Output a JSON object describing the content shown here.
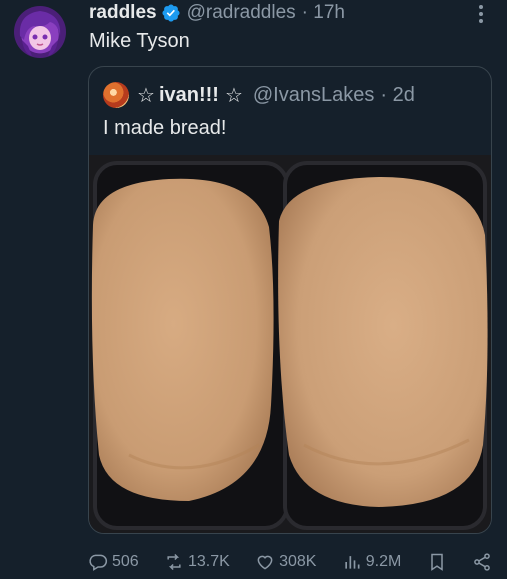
{
  "tweet": {
    "author_name": "raddles",
    "handle": "@radraddles",
    "time": "· 17h",
    "text": "Mike Tyson"
  },
  "quoted": {
    "author_name": "ivan!!!",
    "handle": "@IvansLakes",
    "time": "· 2d",
    "text": "I made bread!",
    "stars": "☆"
  },
  "actions": {
    "replies": "506",
    "retweets": "13.7K",
    "likes": "308K",
    "views": "9.2M"
  },
  "colors": {
    "background": "#15202b",
    "text": "#e7e9ea",
    "muted": "#8b98a5",
    "verified": "#1d9bf0",
    "border": "#38444d"
  },
  "icons": [
    "verified-badge-icon",
    "more-options-icon",
    "reply-icon",
    "retweet-icon",
    "like-icon",
    "views-icon",
    "bookmark-icon",
    "share-icon"
  ]
}
